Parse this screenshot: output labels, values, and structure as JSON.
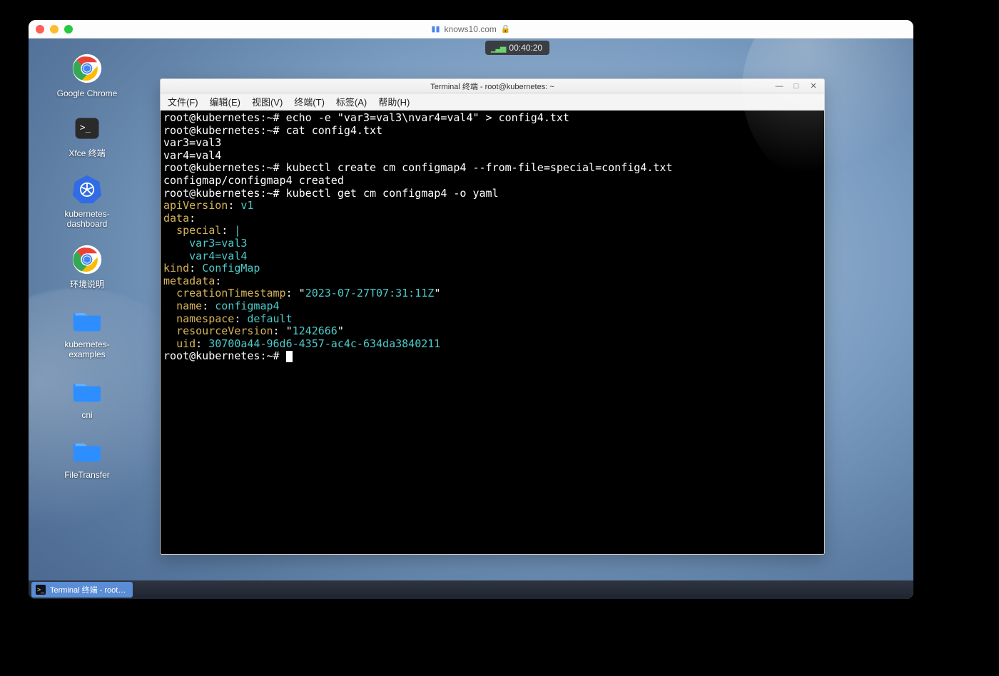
{
  "browser": {
    "address": "knows10.com",
    "status_time": "00:40:20"
  },
  "desktop_icons": [
    {
      "name": "google-chrome",
      "label": "Google Chrome"
    },
    {
      "name": "xfce-terminal",
      "label": "Xfce 终端"
    },
    {
      "name": "k8s-dashboard",
      "label": "kubernetes-\ndashboard"
    },
    {
      "name": "env-help",
      "label": "环境说明"
    },
    {
      "name": "k8s-examples",
      "label": "kubernetes-\nexamples"
    },
    {
      "name": "cni",
      "label": "cni"
    },
    {
      "name": "file-transfer",
      "label": "FileTransfer"
    }
  ],
  "taskbar": {
    "item_label": "Terminal 终端 - root…"
  },
  "terminal_window": {
    "title": "Terminal 终端 - root@kubernetes: ~",
    "menus": [
      "文件(F)",
      "编辑(E)",
      "视图(V)",
      "终端(T)",
      "标签(A)",
      "帮助(H)"
    ],
    "controls": {
      "min": "—",
      "max": "□",
      "close": "✕"
    }
  },
  "terminal": {
    "prompt": "root@kubernetes:~#",
    "cmd1": "echo -e \"var3=val3\\nvar4=val4\" > config4.txt",
    "cmd2": "cat config4.txt",
    "out2a": "var3=val3",
    "out2b": "var4=val4",
    "cmd3": "kubectl create cm configmap4 --from-file=special=config4.txt",
    "out3": "configmap/configmap4 created",
    "cmd4": "kubectl get cm configmap4 -o yaml",
    "yaml": {
      "apiVersion_key": "apiVersion",
      "apiVersion_val": "v1",
      "data_key": "data",
      "special_key": "special",
      "special_pipe": "|",
      "special_l1": "var3=val3",
      "special_l2": "var4=val4",
      "kind_key": "kind",
      "kind_val": "ConfigMap",
      "metadata_key": "metadata",
      "creationTs_key": "creationTimestamp",
      "creationTs_val": "2023-07-27T07:31:11Z",
      "name_key": "name",
      "name_val": "configmap4",
      "namespace_key": "namespace",
      "namespace_val": "default",
      "resourceVersion_key": "resourceVersion",
      "resourceVersion_val": "1242666",
      "uid_key": "uid",
      "uid_val": "30700a44-96d6-4357-ac4c-634da3840211"
    }
  }
}
